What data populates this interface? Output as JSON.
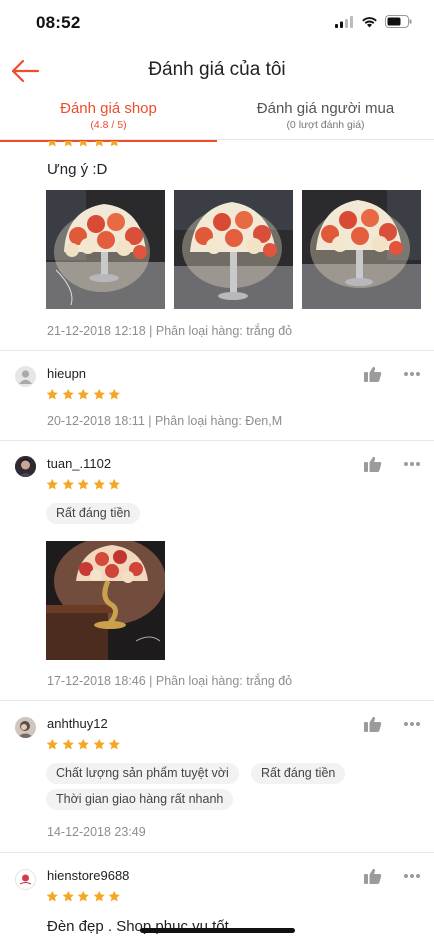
{
  "status_bar": {
    "time": "08:52"
  },
  "header": {
    "title": "Đánh giá của tôi"
  },
  "tabs": [
    {
      "label": "Đánh giá shop",
      "sub": "(4.8 / 5)",
      "active": true
    },
    {
      "label": "Đánh giá người mua",
      "sub": "(0 lượt đánh giá)",
      "active": false
    }
  ],
  "reviews": [
    {
      "comment": "Ưng ý :D",
      "meta": "21-12-2018 12:18 | Phân loại hàng: trắng đỏ",
      "rating": 5
    },
    {
      "username": "hieupn",
      "meta": "20-12-2018 18:11 | Phân loại hàng: Đen,M",
      "rating": 5
    },
    {
      "username": "tuan_.1102",
      "tags": [
        "Rất đáng tiền"
      ],
      "meta": "17-12-2018 18:46 | Phân loại hàng: trắng đỏ",
      "rating": 5
    },
    {
      "username": "anhthuy12",
      "tags": [
        "Chất lượng sản phẩm tuyệt vời",
        "Rất đáng tiền",
        "Thời gian giao hàng rất nhanh"
      ],
      "meta": "14-12-2018 23:49",
      "rating": 5
    },
    {
      "username": "hienstore9688",
      "comment": "Đèn đẹp . Shop phục vụ tốt",
      "rating": 5
    }
  ],
  "colors": {
    "accent": "#ee4d2d",
    "star": "#f5a623",
    "meta": "#8e8e8e"
  }
}
